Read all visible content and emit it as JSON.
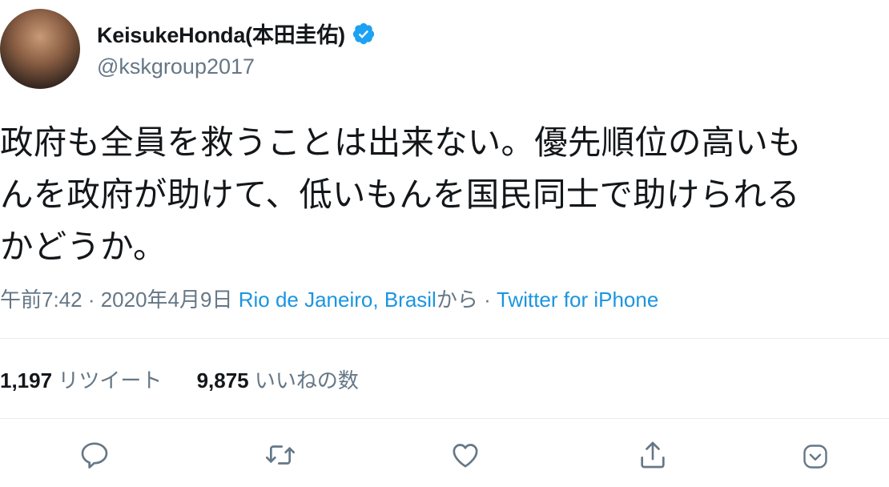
{
  "user": {
    "display_name": "KeisukeHonda(本田圭佑)",
    "handle": "@kskgroup2017",
    "verified": true
  },
  "tweet": {
    "lines": [
      "政府も全員を救うことは出来ない。優先順位の高いも",
      "んを政府が助けて、低いもんを国民同士で助けられる",
      "かどうか。"
    ]
  },
  "meta": {
    "time": "午前7:42",
    "separator": " · ",
    "date": "2020年4月9日",
    "location": "Rio de Janeiro, Brasil",
    "location_suffix": "から",
    "source": "Twitter for iPhone"
  },
  "stats": {
    "retweets_count": "1,197",
    "retweets_label": "リツイート",
    "likes_count": "9,875",
    "likes_label": "いいねの数"
  },
  "colors": {
    "link": "#1b95e0",
    "muted": "#657786",
    "divider": "#e6ecf0",
    "verified": "#1da1f2"
  },
  "icons": [
    "reply-icon",
    "retweet-icon",
    "like-icon",
    "share-icon",
    "more-chevron-icon"
  ]
}
